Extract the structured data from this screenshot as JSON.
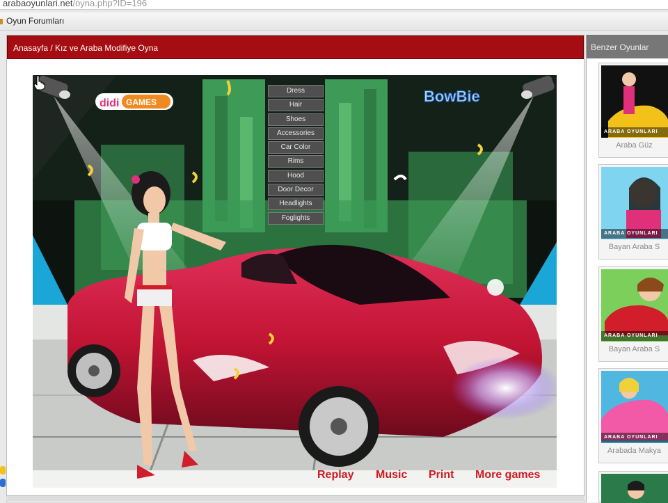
{
  "browser": {
    "url_prefix": "arabaoyunlari.net",
    "url_suffix": "/oyna.php?ID=196"
  },
  "nav": {
    "forum_link": "Oyun Forumları"
  },
  "main_panel": {
    "breadcrumb": "Anasayfa / Kız ve Araba Modifiye Oyna"
  },
  "game": {
    "menu": [
      "Dress",
      "Hair",
      "Shoes",
      "Accessories",
      "Car Color",
      "Rims",
      "Hood",
      "Door Decor",
      "Headlights",
      "Foglights"
    ],
    "logo_left": "didiGAMES",
    "logo_right": "BowBie",
    "links": {
      "replay": "Replay",
      "music": "Music",
      "print": "Print",
      "more_games": "More games"
    }
  },
  "sidebar": {
    "title": "Benzer Oyunlar",
    "games": [
      {
        "caption": "Araba Güz",
        "thumb_label": "ARABA OYUNLARI"
      },
      {
        "caption": "Bayan Araba S",
        "thumb_label": "ARABA OYUNLARI"
      },
      {
        "caption": "Bayan Araba S",
        "thumb_label": "ARABA OYUNLARI"
      },
      {
        "caption": "Arabada Makya",
        "thumb_label": "ARABA OYUNLARI"
      }
    ]
  },
  "colors": {
    "header_red": "#a50d12",
    "link_red": "#d11820",
    "car_red": "#c21433"
  }
}
